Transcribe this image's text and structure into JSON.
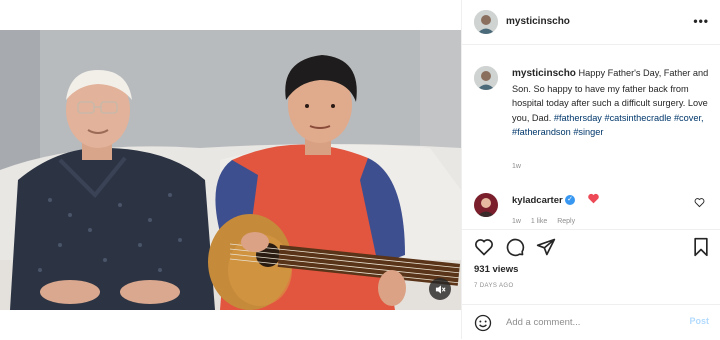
{
  "post": {
    "username": "mysticinscho",
    "more_label": "•••",
    "caption_user": "mysticinscho",
    "caption_text": "Happy Father's Day, Father and Son. So happy to have my father back from hospital today after such a difficult surgery. Love you, Dad.",
    "hashtags": [
      "#fathersday",
      "#catsinthecradle",
      "#cover,",
      "#fatherandson",
      "#singer"
    ],
    "caption_time": "1w",
    "comment": {
      "username": "kyladcarter",
      "verified_mark": "✓",
      "emoji": "heart",
      "time": "1w",
      "likes": "1 like",
      "reply": "Reply"
    },
    "views": "931 views",
    "posted_ago": "7 DAYS AGO",
    "add_comment_placeholder": "Add a comment...",
    "post_label": "Post"
  },
  "colors": {
    "link": "#00376b",
    "verified": "#3897f0",
    "heart": "#ed4956",
    "post_disabled": "#b3dbff"
  },
  "icons": [
    "more-icon",
    "heart-icon",
    "comment-icon",
    "share-icon",
    "bookmark-icon",
    "smile-icon",
    "mute-icon",
    "verified-icon"
  ]
}
